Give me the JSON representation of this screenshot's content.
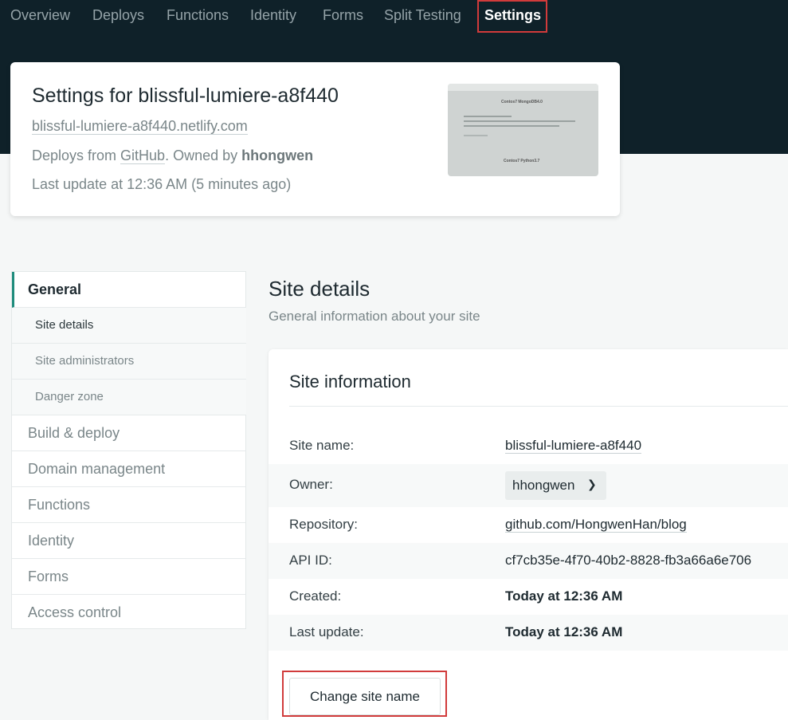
{
  "nav": {
    "items": [
      "Overview",
      "Deploys",
      "Functions",
      "Identity",
      "Forms",
      "Split Testing",
      "Settings"
    ],
    "active": "Settings"
  },
  "site": {
    "title": "Settings for blissful-lumiere-a8f440",
    "url": "blissful-lumiere-a8f440.netlify.com",
    "deploys_prefix": "Deploys from ",
    "provider": "GitHub",
    "owned_by": ". Owned by ",
    "owner": "hhongwen",
    "last_update": "Last update at 12:36 AM (5 minutes ago)",
    "preview_heading_1": "Contos7\u0000MongoDB4.0",
    "preview_heading_2": "Contos7\u0000Python3.7"
  },
  "sidebar": {
    "items": [
      "General",
      "Site details",
      "Site administrators",
      "Danger zone",
      "Build & deploy",
      "Domain management",
      "Functions",
      "Identity",
      "Forms",
      "Access control"
    ]
  },
  "section": {
    "title": "Site details",
    "subtitle": "General information about your site"
  },
  "info": {
    "title": "Site information",
    "rows": [
      {
        "label": "Site name:",
        "value": "blissful-lumiere-a8f440"
      },
      {
        "label": "Owner:",
        "value": "hhongwen"
      },
      {
        "label": "Repository:",
        "value": "github.com/HongwenHan/blog"
      },
      {
        "label": "API ID:",
        "value": "cf7cb35e-4f70-40b2-8828-fb3a66a6e706"
      },
      {
        "label": "Created:",
        "value": "Today at 12:36 AM"
      },
      {
        "label": "Last update:",
        "value": "Today at 12:36 AM"
      }
    ],
    "change_button": "Change site name"
  },
  "colors": {
    "header_bg": "#0f2129",
    "accent": "#1f8c7c",
    "highlight_box": "#d13b3b"
  }
}
